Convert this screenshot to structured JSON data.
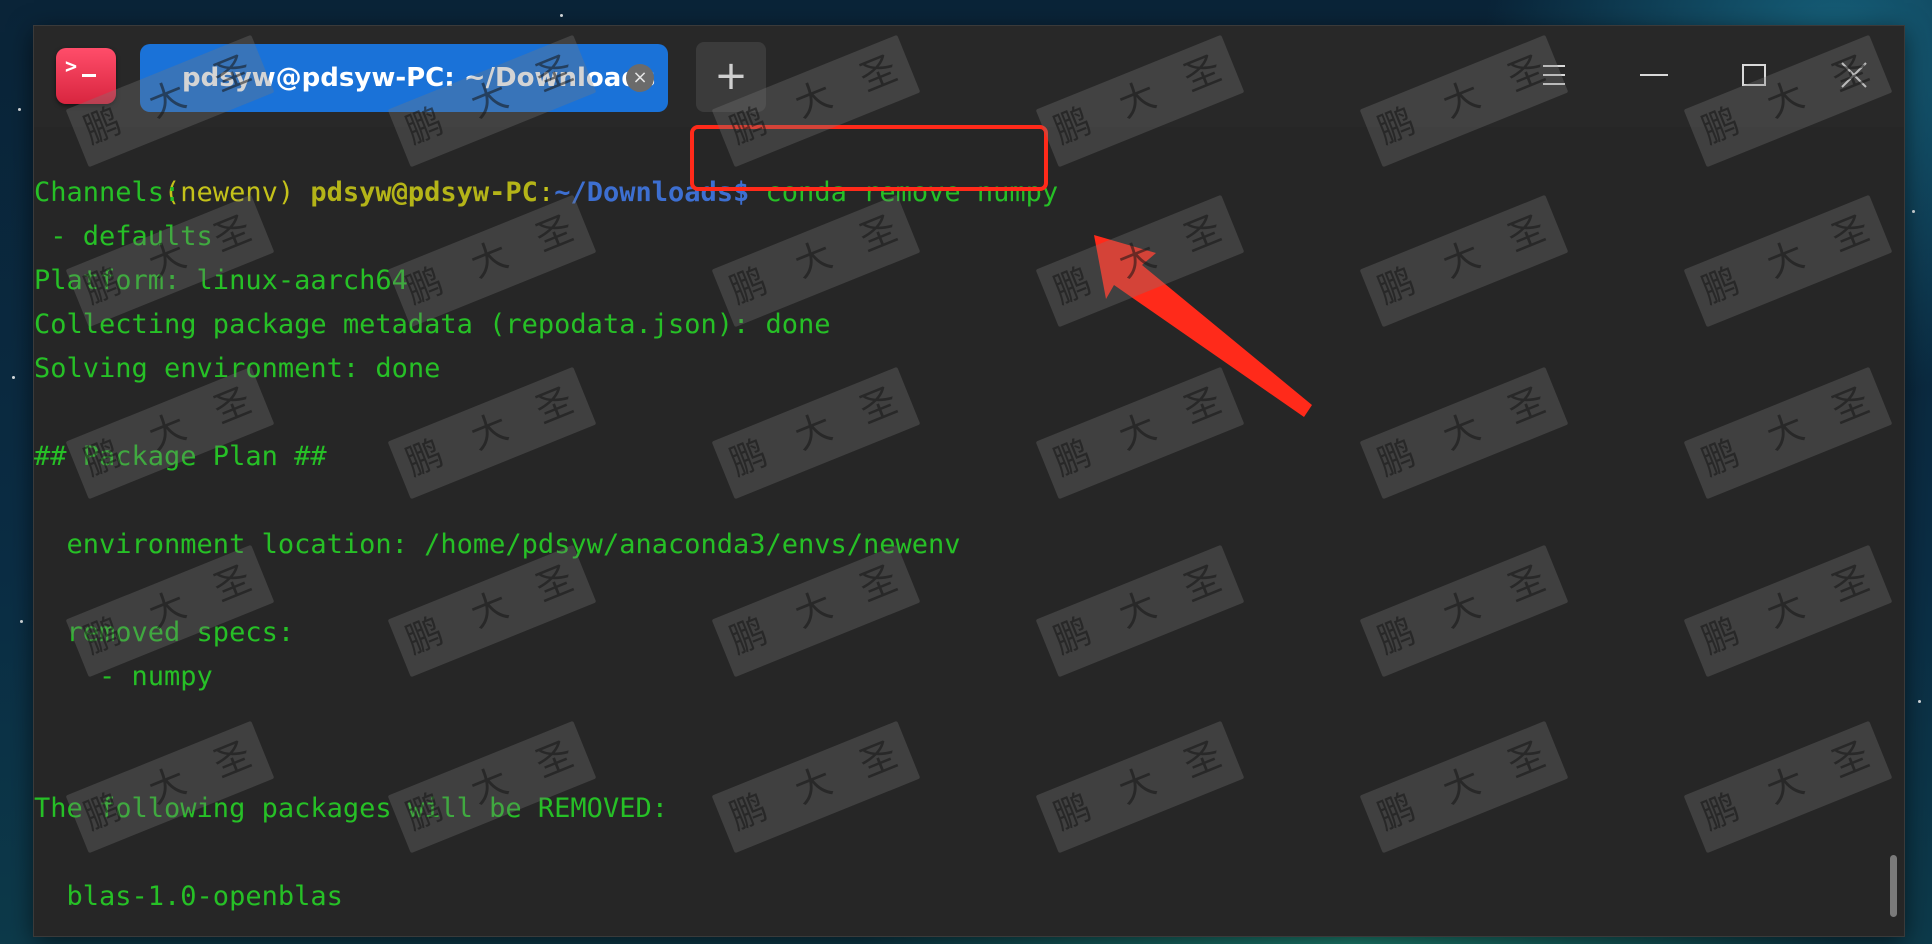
{
  "window": {
    "tab_title": "pdsyw@pdsyw-PC: ~/Downloads",
    "tab_close": "×",
    "new_tab": "+"
  },
  "terminal": {
    "prompt": {
      "venv": "(newenv)",
      "userhost": "pdsyw@pdsyw-PC",
      "colon": ":",
      "cwd": "~/Downloads",
      "dollar": "$",
      "command": "conda remove numpy"
    },
    "lines": [
      "Channels:",
      " - defaults",
      "Platform: linux-aarch64",
      "Collecting package metadata (repodata.json): done",
      "Solving environment: done",
      "",
      "## Package Plan ##",
      "",
      "  environment location: /home/pdsyw/anaconda3/envs/newenv",
      "",
      "  removed specs:",
      "    - numpy",
      "",
      "",
      "The following packages will be REMOVED:",
      "",
      "  blas-1.0-openblas"
    ]
  },
  "watermark": {
    "char1": "鹏",
    "char2": "大",
    "char3": "圣"
  },
  "colors": {
    "tab_active": "#1a72d8",
    "terminal_bg": "#262626",
    "output_green": "#26c026",
    "prompt_yellow": "#c4c21a",
    "prompt_blue": "#3d6fd1",
    "annotation_red": "#ff2a1a"
  },
  "icons": {
    "app": "terminal-icon",
    "menu": "hamburger-menu-icon",
    "minimize": "minimize-icon",
    "maximize": "maximize-icon",
    "close": "close-icon",
    "annotation": "red-arrow-icon"
  }
}
